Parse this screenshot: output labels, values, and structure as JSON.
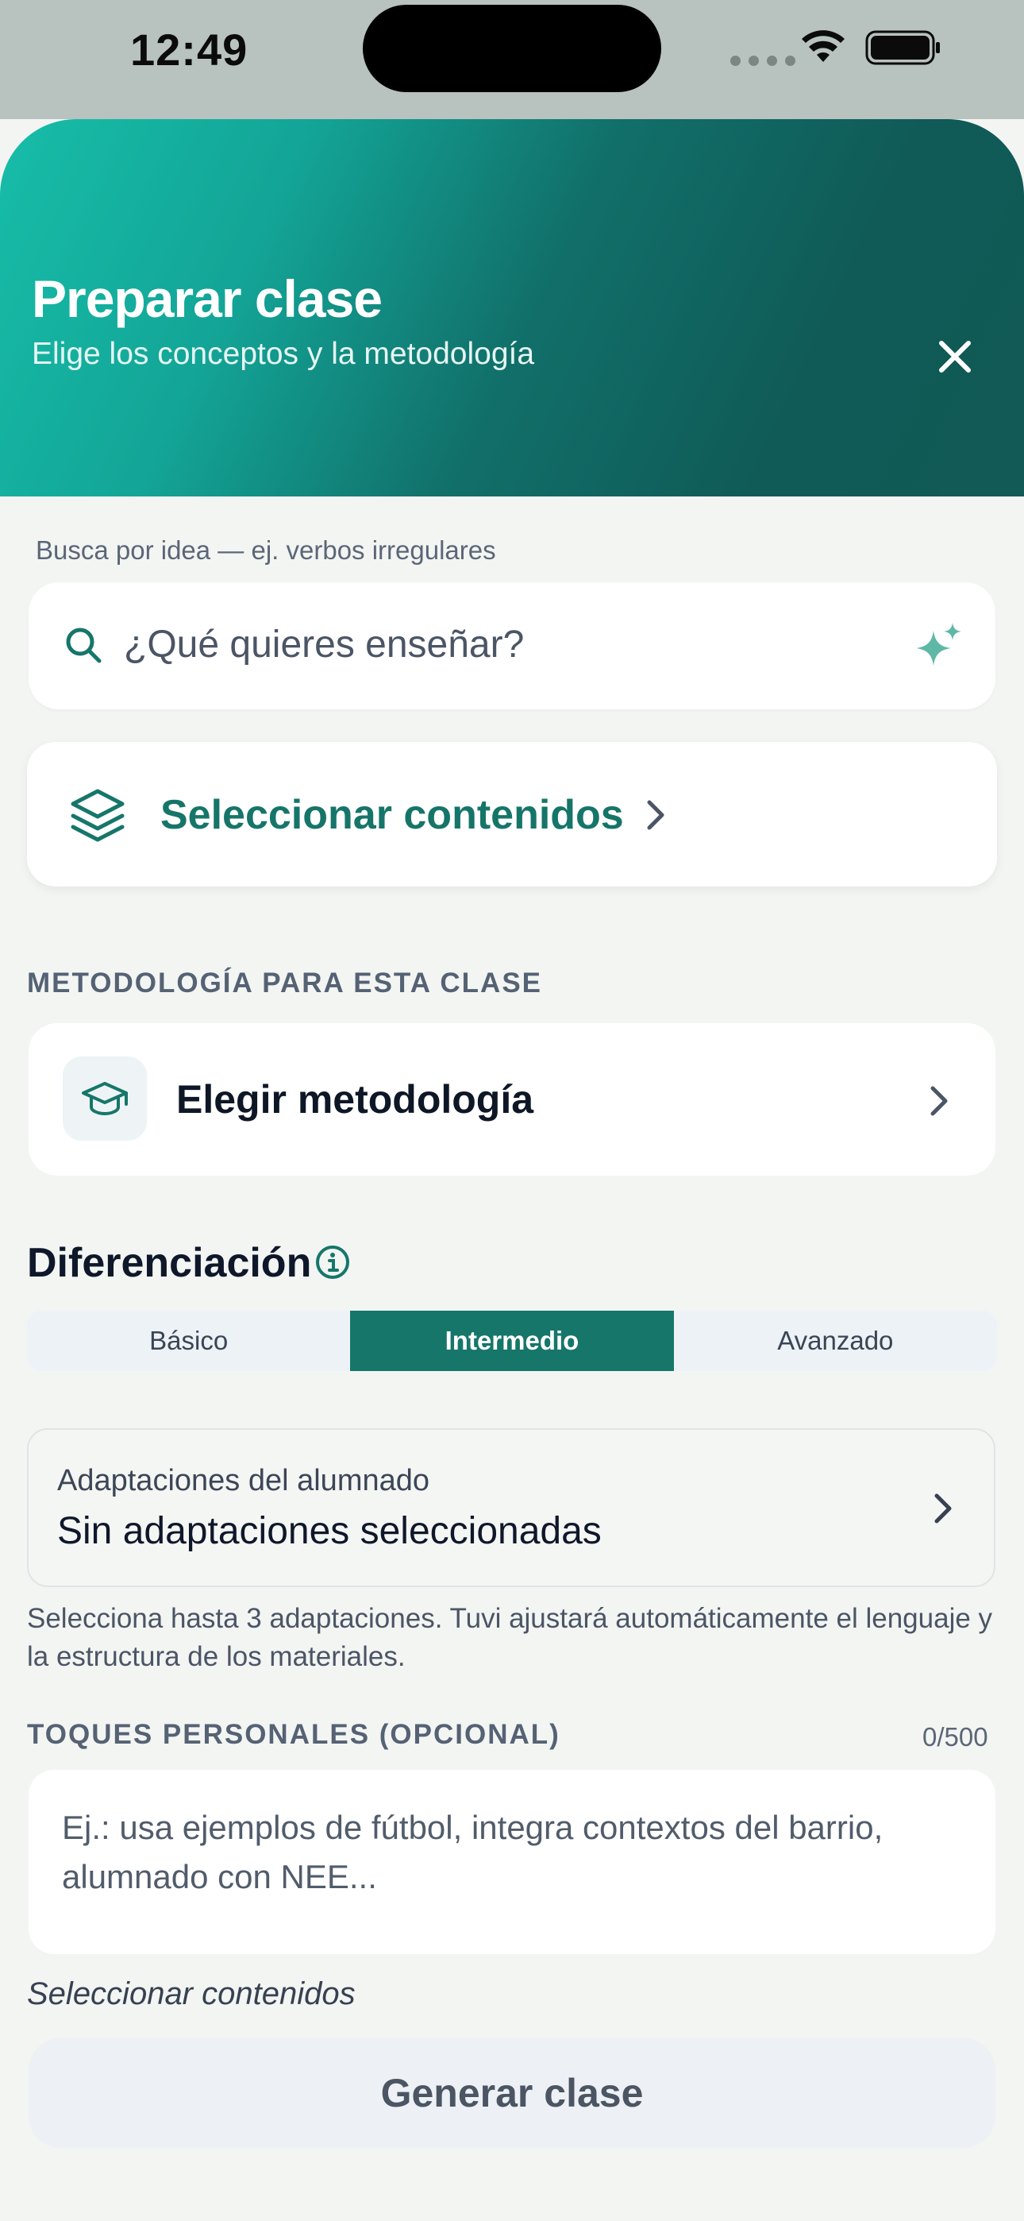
{
  "status_bar": {
    "time": "12:49"
  },
  "header": {
    "title": "Preparar clase",
    "subtitle": "Elige los conceptos y la metodología"
  },
  "search": {
    "hint": "Busca por idea — ej. verbos irregulares",
    "placeholder": "¿Qué quieres enseñar?"
  },
  "content_select": {
    "label": "Seleccionar contenidos"
  },
  "methodology": {
    "section_label": "METODOLOGÍA PARA ESTA CLASE",
    "button_label": "Elegir metodología"
  },
  "differentiation": {
    "title": "Diferenciación",
    "levels": [
      "Básico",
      "Intermedio",
      "Avanzado"
    ],
    "selected": "Intermedio"
  },
  "adaptations": {
    "label": "Adaptaciones del alumnado",
    "value": "Sin adaptaciones seleccionadas",
    "help": "Selecciona hasta 3 adaptaciones. Tuvi ajustará automáticamente el lenguaje y la estructura de los materiales."
  },
  "personal_touches": {
    "section_label": "TOQUES PERSONALES (OPCIONAL)",
    "counter": "0/500",
    "placeholder": "Ej.: usa ejemplos de fútbol, integra contextos del barrio, alumnado con NEE..."
  },
  "footer": {
    "note": "Seleccionar contenidos",
    "generate_label": "Generar clase"
  },
  "colors": {
    "accent": "#16766a",
    "header_gradient_start": "#17bda8",
    "header_gradient_end": "#105a57"
  }
}
